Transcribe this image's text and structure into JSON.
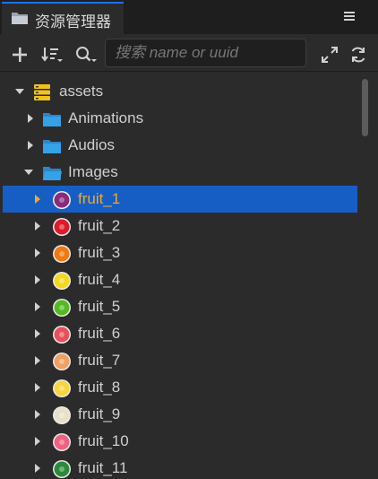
{
  "tab": {
    "title": "资源管理器"
  },
  "toolbar": {
    "search_placeholder": "搜索 name or uuid"
  },
  "tree": {
    "root": {
      "label": "assets",
      "expanded": true
    },
    "folders": [
      {
        "label": "Animations",
        "expanded": false
      },
      {
        "label": "Audios",
        "expanded": false
      },
      {
        "label": "Images",
        "expanded": true
      }
    ],
    "images": [
      {
        "label": "fruit_1",
        "selected": true,
        "color": "#8a2a7a"
      },
      {
        "label": "fruit_2",
        "selected": false,
        "color": "#e01a2a"
      },
      {
        "label": "fruit_3",
        "selected": false,
        "color": "#f07a10"
      },
      {
        "label": "fruit_4",
        "selected": false,
        "color": "#f4d81e"
      },
      {
        "label": "fruit_5",
        "selected": false,
        "color": "#56b822"
      },
      {
        "label": "fruit_6",
        "selected": false,
        "color": "#e8505a"
      },
      {
        "label": "fruit_7",
        "selected": false,
        "color": "#f0a060"
      },
      {
        "label": "fruit_8",
        "selected": false,
        "color": "#f8d63a"
      },
      {
        "label": "fruit_9",
        "selected": false,
        "color": "#e8e0c8"
      },
      {
        "label": "fruit_10",
        "selected": false,
        "color": "#f06080"
      },
      {
        "label": "fruit_11",
        "selected": false,
        "color": "#2a8a3a"
      }
    ]
  },
  "colors": {
    "selection": "#175ec4",
    "selected_text": "#f0a92a",
    "folder": "#35a2e8",
    "tab_accent": "#1a73e8"
  }
}
